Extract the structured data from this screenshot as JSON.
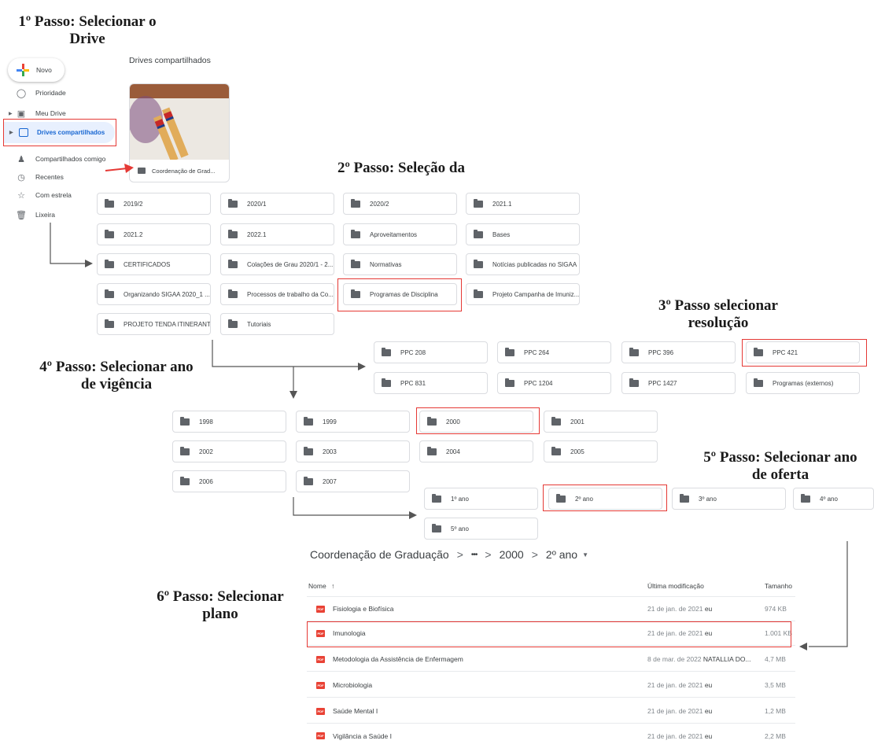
{
  "steps": {
    "s1": "1º Passo: Selecionar o Drive",
    "s2": "2º Passo: Seleção da",
    "s3": "3º Passo selecionar resolução",
    "s4": "4º Passo: Selecionar ano de vigência",
    "s5": "5º Passo: Selecionar ano de oferta",
    "s6": "6º Passo: Selecionar plano"
  },
  "sidebar": {
    "new_label": "Novo",
    "items": [
      "Prioridade",
      "Meu Drive",
      "Drives compartilhados",
      "Compartilhados comigo",
      "Recentes",
      "Com estrela",
      "Lixeira"
    ]
  },
  "shared_drives": {
    "title": "Drives compartilhados",
    "drive_name": "Coordenação de Grad..."
  },
  "folders_step2": [
    "2019/2",
    "2020/1",
    "2020/2",
    "2021.1",
    "2021.2",
    "2022.1",
    "Aproveitamentos",
    "Bases",
    "CERTIFICADOS",
    "Colações de Grau 2020/1 - 2...",
    "Normativas",
    "Notícias publicadas no SIGAA",
    "Organizando SIGAA 2020_1 ...",
    "Processos de trabalho da Co...",
    "Programas de Disciplina",
    "Projeto Campanha de Imuniz...",
    "PROJETO TENDA ITINERANTE",
    "Tutoriais"
  ],
  "folders_step3": [
    "PPC 208",
    "PPC 264",
    "PPC 396",
    "PPC 421",
    "PPC 831",
    "PPC 1204",
    "PPC 1427",
    "Programas (externos)"
  ],
  "folders_step4": [
    "1998",
    "1999",
    "2000",
    "2001",
    "2002",
    "2003",
    "2004",
    "2005",
    "2006",
    "2007"
  ],
  "folders_step5": [
    "1º ano",
    "2º ano",
    "3º ano",
    "4º ano",
    "5º ano"
  ],
  "breadcrumb": {
    "root": "Coordenação de Graduação",
    "sep": ">",
    "ellipsis": "•••",
    "level1": "2000",
    "current": "2º ano"
  },
  "file_table": {
    "headers": {
      "name": "Nome",
      "modified": "Última modificação",
      "size": "Tamanho"
    },
    "rows": [
      {
        "name": "Fisiologia e Biofísica",
        "date": "21 de jan. de 2021",
        "owner": "eu",
        "size": "974 KB"
      },
      {
        "name": "Imunologia",
        "date": "21 de jan. de 2021",
        "owner": "eu",
        "size": "1.001 KB"
      },
      {
        "name": "Metodologia da Assistência de Enfermagem",
        "date": "8 de mar. de 2022",
        "owner": "NATALLIA DO...",
        "size": "4,7 MB"
      },
      {
        "name": "Microbiologia",
        "date": "21 de jan. de 2021",
        "owner": "eu",
        "size": "3,5 MB"
      },
      {
        "name": "Saúde Mental I",
        "date": "21 de jan. de 2021",
        "owner": "eu",
        "size": "1,2 MB"
      },
      {
        "name": "Vigilância a Saúde I",
        "date": "21 de jan. de 2021",
        "owner": "eu",
        "size": "2,2 MB"
      }
    ]
  },
  "pdf_label": "PDF",
  "colors": {
    "accent_red": "#e53935",
    "selected_bg": "#e8f0fe",
    "selected_text": "#1967d2"
  }
}
